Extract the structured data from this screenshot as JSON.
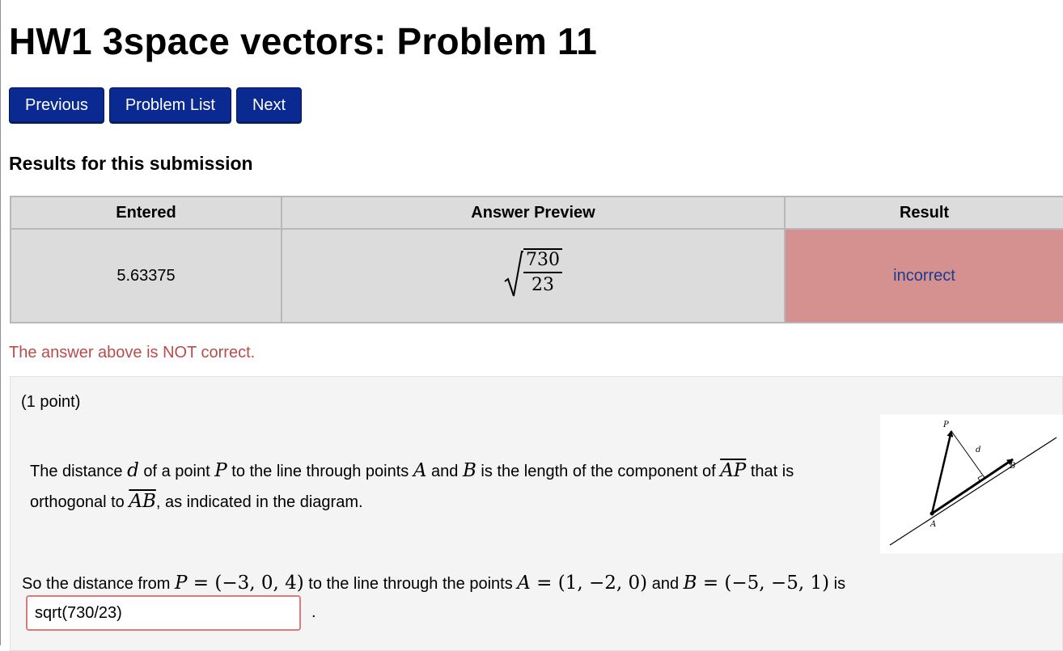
{
  "page": {
    "title": "HW1 3space vectors: Problem 11"
  },
  "nav": {
    "previous": "Previous",
    "problem_list": "Problem List",
    "next": "Next"
  },
  "results": {
    "heading": "Results for this submission",
    "columns": [
      "Entered",
      "Answer Preview",
      "Result"
    ],
    "row": {
      "entered": "5.63375",
      "preview_numerator": "730",
      "preview_denominator": "23",
      "result": "incorrect"
    },
    "result_color": "#d59090"
  },
  "message": "The answer above is NOT correct.",
  "problem": {
    "points": "(1 point)",
    "statement": {
      "s1": "The distance ",
      "d": "d",
      "s2": " of a point ",
      "P": "P",
      "s3": " to the line through points ",
      "A": "A",
      "s4": " and ",
      "B": "B",
      "s5": " is the length of the component of ",
      "AP": "AP",
      "s6": " that is",
      "s7": "orthogonal to ",
      "AB": "AB",
      "s8": ", as indicated in the diagram."
    },
    "diagram": {
      "label_P": "P",
      "label_d": "d",
      "label_B": "B",
      "label_A": "A"
    },
    "question": {
      "s1": "So the distance from ",
      "P_eq": "P = (−3, 0, 4)",
      "s2": " to the line through the points ",
      "A_eq": "A = (1, −2, 0)",
      "s3": " and ",
      "B_eq": "B = (−5, −5, 1)",
      "s4": " is"
    },
    "answer_value": "sqrt(730/23)",
    "period": "."
  },
  "colors": {
    "nav_button": "#0b2a91",
    "incorrect_text": "#b74c4c",
    "panel_bg": "#f4f4f4"
  }
}
